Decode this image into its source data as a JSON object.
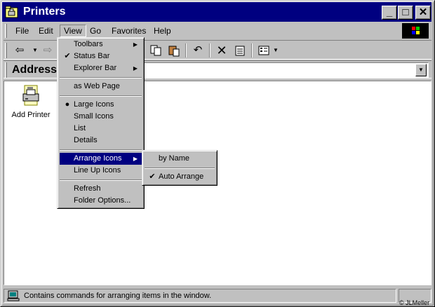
{
  "window": {
    "title": "Printers"
  },
  "titlebar_buttons": {
    "minimize": "_",
    "maximize": "□",
    "close": "✕"
  },
  "menubar": {
    "items": [
      "File",
      "Edit",
      "View",
      "Go",
      "Favorites",
      "Help"
    ]
  },
  "toolbar": {
    "icons": [
      "back-arrow-icon",
      "dropdown-arrow-icon",
      "forward-arrow-icon",
      "copy-icon",
      "paste-icon",
      "undo-icon",
      "delete-icon",
      "properties-icon",
      "views-icon",
      "dropdown-arrow-icon"
    ]
  },
  "address": {
    "label": "Address",
    "value": ""
  },
  "content": {
    "items": [
      {
        "label": "Add Printer",
        "icon": "printer-icon"
      }
    ]
  },
  "view_menu": {
    "items": [
      {
        "label": "Toolbars",
        "mark": "",
        "submenu": true
      },
      {
        "label": "Status Bar",
        "mark": "✔",
        "submenu": false
      },
      {
        "label": "Explorer Bar",
        "mark": "",
        "submenu": true
      },
      {
        "label": "as Web Page",
        "mark": "",
        "submenu": false
      },
      {
        "label": "Large Icons",
        "mark": "●",
        "submenu": false
      },
      {
        "label": "Small Icons",
        "mark": "",
        "submenu": false
      },
      {
        "label": "List",
        "mark": "",
        "submenu": false
      },
      {
        "label": "Details",
        "mark": "",
        "submenu": false
      },
      {
        "label": "Arrange Icons",
        "mark": "",
        "submenu": true,
        "highlighted": true
      },
      {
        "label": "Line Up Icons",
        "mark": "",
        "submenu": false
      },
      {
        "label": "Refresh",
        "mark": "",
        "submenu": false
      },
      {
        "label": "Folder Options...",
        "mark": "",
        "submenu": false
      }
    ]
  },
  "arrange_submenu": {
    "items": [
      {
        "label": "by Name",
        "mark": ""
      },
      {
        "label": "Auto Arrange",
        "mark": "✔"
      }
    ]
  },
  "status": {
    "text": "Contains commands for arranging items in the window."
  },
  "credit": "© JLMeller",
  "colors": {
    "titlebar": "#000080",
    "highlight": "#000080",
    "face": "#c0c0c0"
  }
}
